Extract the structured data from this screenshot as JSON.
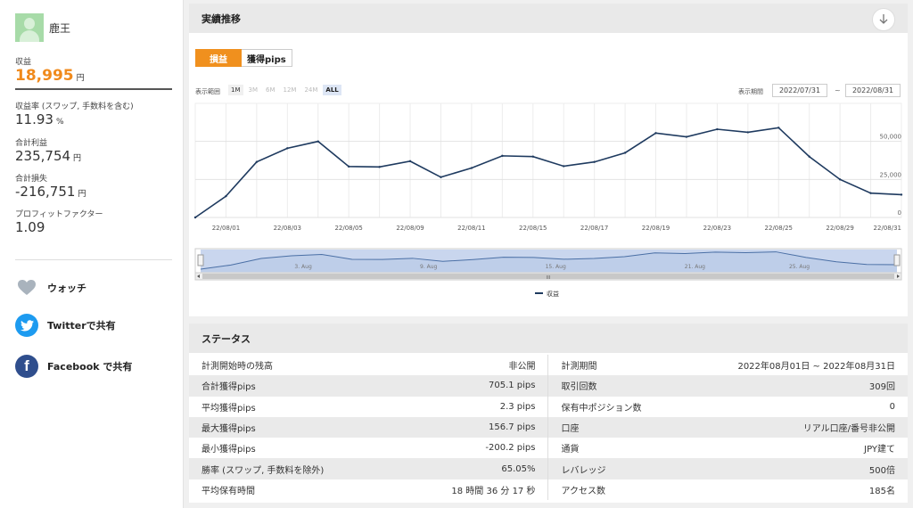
{
  "user": {
    "name": "鹿王"
  },
  "sidebar": {
    "profit_label": "収益",
    "profit_value": "18,995",
    "unit": "円",
    "return_rate_label": "収益率 (スワップ, 手数料を含む)",
    "return_rate_value": "11.93",
    "percent_unit": "%",
    "total_profit_label": "合計利益",
    "total_profit_value": "235,754",
    "total_loss_label": "合計損失",
    "total_loss_value": "-216,751",
    "pf_label": "プロフィットファクター",
    "pf_value": "1.09",
    "watch_label": "ウォッチ",
    "twitter_label": "Twitterで共有",
    "facebook_label": "Facebook で共有",
    "facebook_glyph": "f"
  },
  "performance": {
    "title": "実績推移",
    "tabs": [
      "損益",
      "獲得pips"
    ],
    "range_label": "表示範囲",
    "range_options": [
      "1M",
      "3M",
      "6M",
      "12M",
      "24M",
      "ALL"
    ],
    "period_label": "表示期間",
    "date_from": "2022/07/31",
    "date_to": "2022/08/31",
    "tilde": "~"
  },
  "chart_data": {
    "type": "line",
    "series": [
      {
        "name": "収益",
        "x": [
          "22/07/31",
          "22/08/01",
          "22/08/02",
          "22/08/03",
          "22/08/04",
          "22/08/05",
          "22/08/07",
          "22/08/09",
          "22/08/10",
          "22/08/11",
          "22/08/12",
          "22/08/15",
          "22/08/16",
          "22/08/17",
          "22/08/18",
          "22/08/19",
          "22/08/22",
          "22/08/23",
          "22/08/24",
          "22/08/25",
          "22/08/26",
          "22/08/29",
          "22/08/30",
          "22/08/31"
        ],
        "values": [
          0,
          14000,
          36500,
          45500,
          50000,
          33500,
          33200,
          37000,
          26500,
          32500,
          40500,
          40000,
          33700,
          36500,
          42500,
          55500,
          53000,
          58000,
          56000,
          59000,
          40000,
          25000,
          16000,
          15000
        ]
      }
    ],
    "x_tick_labels": [
      "22/08/01",
      "22/08/03",
      "22/08/05",
      "22/08/09",
      "22/08/11",
      "22/08/15",
      "22/08/17",
      "22/08/19",
      "22/08/23",
      "22/08/25",
      "22/08/29",
      "22/08/31"
    ],
    "y_tick_labels": [
      "0",
      "25,000",
      "50,000"
    ],
    "ylim": [
      0,
      75000
    ],
    "grid": true,
    "legend": "bottom",
    "color": "#1e3a5f",
    "navigator_labels": [
      "3. Aug",
      "9. Aug",
      "15. Aug",
      "21. Aug",
      "25. Aug"
    ],
    "navigator_handle_glyph": "III"
  },
  "status": {
    "title": "ステータス",
    "rows": [
      {
        "k1": "計測開始時の残高",
        "v1": "非公開",
        "k2": "計測期間",
        "v2": "2022年08月01日 ~ 2022年08月31日"
      },
      {
        "k1": "合計獲得pips",
        "v1": "705.1 pips",
        "k2": "取引回数",
        "v2": "309回"
      },
      {
        "k1": "平均獲得pips",
        "v1": "2.3 pips",
        "k2": "保有中ポジション数",
        "v2": "0"
      },
      {
        "k1": "最大獲得pips",
        "v1": "156.7 pips",
        "k2": "口座",
        "v2": "リアル口座/番号非公開"
      },
      {
        "k1": "最小獲得pips",
        "v1": "-200.2 pips",
        "k2": "通貨",
        "v2": "JPY建て"
      },
      {
        "k1": "勝率 (スワップ, 手数料を除外)",
        "v1": "65.05%",
        "k2": "レバレッジ",
        "v2": "500倍"
      },
      {
        "k1": "平均保有時間",
        "v1": "18 時間 36 分 17 秒",
        "k2": "アクセス数",
        "v2": "185名"
      }
    ]
  },
  "colors": {
    "accent": "#f0901e",
    "line": "#1e3a5f",
    "twitter": "#1d9bf0",
    "facebook": "#2f4e8d"
  },
  "icons": {
    "watch": "heart-icon",
    "twitter": "twitter-bird-icon",
    "facebook": "facebook-icon",
    "collapse": "arrow-down-icon"
  }
}
